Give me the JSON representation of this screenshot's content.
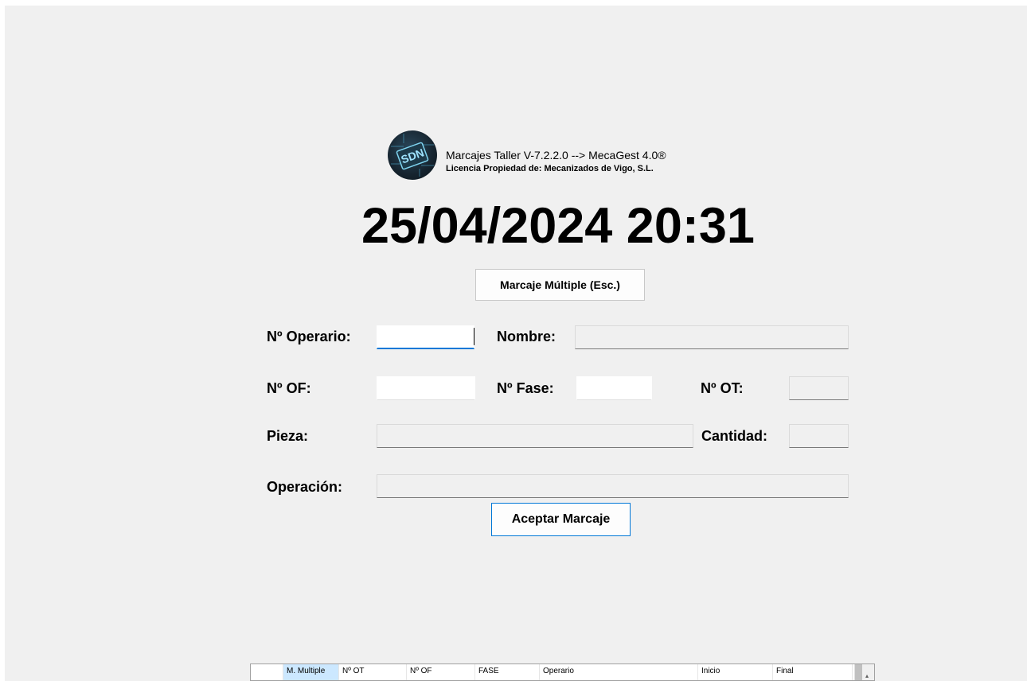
{
  "header": {
    "app_title": "Marcajes Taller V-7.2.2.0 --> MecaGest 4.0®",
    "license": "Licencia Propiedad de: Mecanizados de Vigo, S.L.",
    "logo_icon": "chip-logo-icon",
    "logo_text": "SDN"
  },
  "datetime": "25/04/2024 20:31",
  "buttons": {
    "multiple": "Marcaje Múltiple  (Esc.)",
    "accept": "Aceptar Marcaje"
  },
  "form": {
    "operario_label": "Nº Operario:",
    "operario_value": "",
    "nombre_label": "Nombre:",
    "nombre_value": "",
    "of_label": "Nº OF:",
    "of_value": "",
    "fase_label": "Nº Fase:",
    "fase_value": "",
    "ot_label": "Nº OT:",
    "ot_value": "",
    "pieza_label": "Pieza:",
    "pieza_value": "",
    "cantidad_label": "Cantidad:",
    "cantidad_value": "",
    "operacion_label": "Operación:",
    "operacion_value": ""
  },
  "grid": {
    "columns": [
      "",
      "M. Multiple",
      "Nº OT",
      "Nº OF",
      "FASE",
      "Operario",
      "Inicio",
      "Final"
    ]
  },
  "colors": {
    "background": "#f0f0f0",
    "focus_accent": "#0078d7",
    "selected_header": "#cce8ff"
  }
}
